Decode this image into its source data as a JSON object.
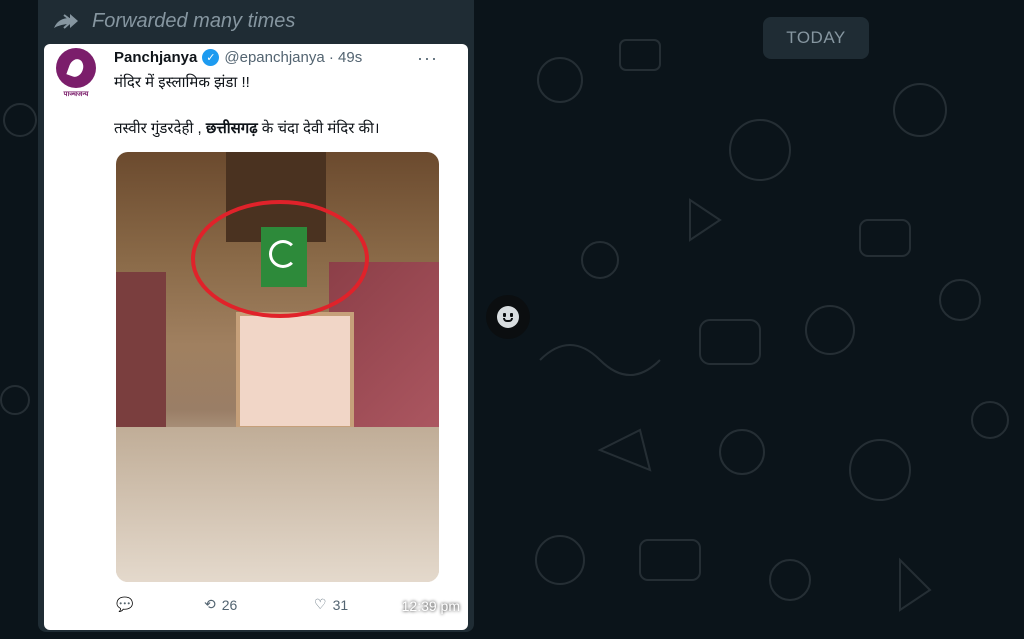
{
  "chat": {
    "date_badge": "TODAY",
    "forwarded_label": "Forwarded many times"
  },
  "tweet": {
    "account_name": "Panchjanya",
    "handle_time": "@epanchjanya · 49s",
    "avatar_caption": "पाञ्चजन्य",
    "line1": "मंदिर में इस्लामिक झंडा !!",
    "line2_pre": "तस्वीर गुंडरदेही , ",
    "line2_bold": "छत्तीसगढ़",
    "line2_post": " के चंदा देवी मंदिर की।",
    "more": "···",
    "retweet_count": "26",
    "like_count": "31"
  },
  "message": {
    "time": "12:39 pm"
  },
  "colors": {
    "chat_bg": "#0b141a",
    "bubble": "#1f2c34",
    "verified": "#1d9bf0",
    "circle": "#e0222a"
  }
}
